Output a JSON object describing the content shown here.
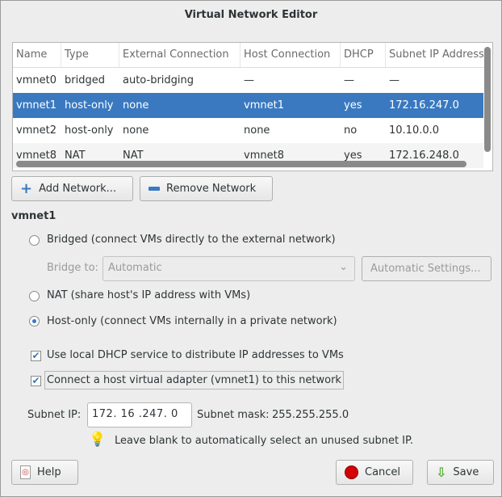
{
  "window": {
    "title": "Virtual Network Editor"
  },
  "table": {
    "columns": [
      "Name",
      "Type",
      "External Connection",
      "Host Connection",
      "DHCP",
      "Subnet IP Address"
    ],
    "rows": [
      [
        "vmnet0",
        "bridged",
        "auto-bridging",
        "—",
        "—",
        "—"
      ],
      [
        "vmnet1",
        "host-only",
        "none",
        "vmnet1",
        "yes",
        "172.16.247.0"
      ],
      [
        "vmnet2",
        "host-only",
        "none",
        "none",
        "no",
        "10.10.0.0"
      ],
      [
        "vmnet8",
        "NAT",
        "NAT",
        "vmnet8",
        "yes",
        "172.16.248.0"
      ]
    ],
    "selected_row": 1
  },
  "buttons": {
    "add": "Add Network...",
    "remove": "Remove Network",
    "auto_settings": "Automatic Settings...",
    "help": "Help",
    "cancel": "Cancel",
    "save": "Save"
  },
  "section": {
    "title": "vmnet1"
  },
  "options": {
    "bridged": "Bridged (connect VMs directly to the external network)",
    "bridge_to_label": "Bridge to:",
    "bridge_to_value": "Automatic",
    "nat": "NAT (share host's IP address with VMs)",
    "host_only": "Host-only (connect VMs internally in a private network)",
    "selected": "host_only",
    "dhcp": "Use local DHCP service to distribute IP addresses to VMs",
    "dhcp_checked": true,
    "adapter": "Connect a host virtual adapter (vmnet1) to this network",
    "adapter_checked": true
  },
  "subnet": {
    "ip_label": "Subnet IP:",
    "ip_value": "172. 16 .247.  0",
    "mask_label": "Subnet mask:",
    "mask_value": "255.255.255.0",
    "hint": "Leave blank to automatically select an unused subnet IP."
  },
  "colors": {
    "selection": "#3a79c0"
  }
}
